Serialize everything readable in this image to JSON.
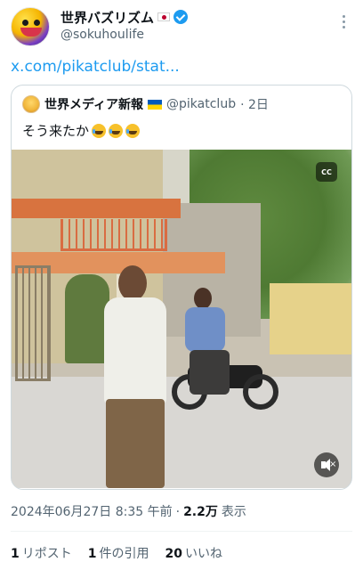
{
  "account": {
    "name": "世界バズリズム",
    "handle": "@sokuhoulife",
    "avatar_icon": "cartoon-face-avatar",
    "flag_icon": "japan-flag-icon",
    "verified": true
  },
  "tweet": {
    "link_text": "x.com/pikatclub/stat..."
  },
  "quoted_tweet": {
    "name": "世界メディア新報",
    "flag_icon": "ukraine-flag-icon",
    "handle": "@pikatclub",
    "time": "· 2日",
    "text": "そう来たか",
    "emojis": [
      "rolling-on-floor-laughing-emoji",
      "rolling-on-floor-laughing-emoji",
      "rolling-on-floor-laughing-emoji"
    ],
    "video": {
      "cc_label": "CC",
      "mute_icon": "speaker-muted-icon"
    }
  },
  "meta": {
    "date": "2024年06月27日 8:35 午前",
    "separator": "·",
    "views_count": "2.2万",
    "views_label": "表示"
  },
  "stats": {
    "reposts_count": "1",
    "reposts_label": "リポスト",
    "quotes_count": "1",
    "quotes_label": "件の引用",
    "likes_count": "20",
    "likes_label": "いいね"
  },
  "colors": {
    "accent": "#1d9bf0",
    "secondary_text": "#536471"
  }
}
